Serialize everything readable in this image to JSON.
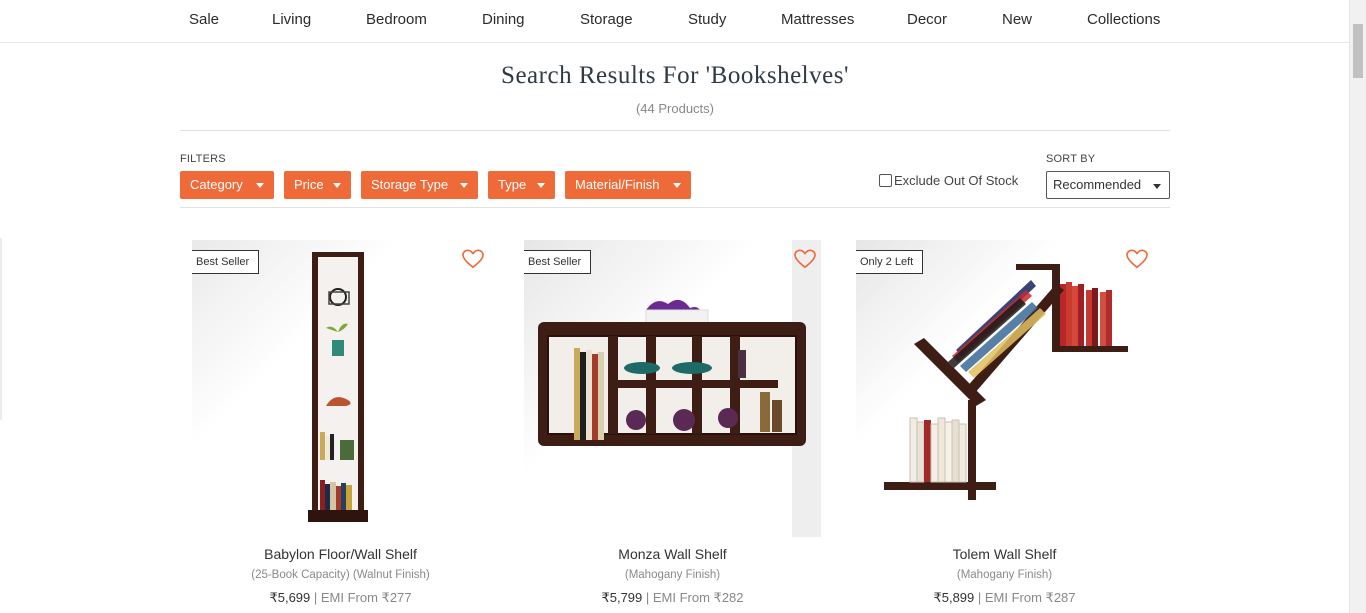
{
  "nav": {
    "items": [
      "Sale",
      "Living",
      "Bedroom",
      "Dining",
      "Storage",
      "Study",
      "Mattresses",
      "Decor",
      "New",
      "Collections"
    ]
  },
  "search": {
    "title": "Search Results For 'Bookshelves'",
    "count": "(44 Products)"
  },
  "filters": {
    "label": "FILTERS",
    "buttons": [
      "Category",
      "Price",
      "Storage Type",
      "Type",
      "Material/Finish"
    ],
    "exclude_label": "Exclude Out Of Stock",
    "exclude_checked": false
  },
  "sort": {
    "label": "SORT BY",
    "selected": "Recommended"
  },
  "products": [
    {
      "badge": "Best Seller",
      "name": "Babylon Floor/Wall Shelf",
      "sub": "(25-Book Capacity) (Walnut Finish)",
      "price": "₹5,699",
      "emi": " | EMI From ₹277"
    },
    {
      "badge": "Best Seller",
      "name": "Monza Wall Shelf",
      "sub": "(Mahogany Finish)",
      "price": "₹5,799",
      "emi": " | EMI From ₹282"
    },
    {
      "badge": "Only 2 Left",
      "name": "Tolem Wall Shelf",
      "sub": "(Mahogany Finish)",
      "price": "₹5,899",
      "emi": " | EMI From ₹287"
    }
  ],
  "colors": {
    "accent": "#ee6a39",
    "wood": "#3d1d14"
  },
  "icons": {
    "wishlist": "heart-outline-icon",
    "dropdown": "caret-down-icon"
  }
}
